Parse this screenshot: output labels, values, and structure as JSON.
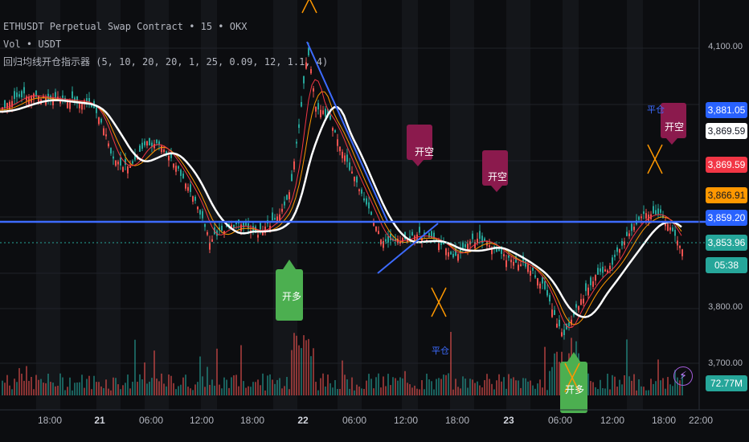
{
  "header": {
    "symbol_line": "ETHUSDT Perpetual Swap Contract • 15 • OKX",
    "volume_line": "Vol • USDT",
    "indicator_line": "回归均线开仓指示器 (5, 10, 20, 20, 1, 25, 0.09, 12, 1.1, 4)"
  },
  "price_axis": {
    "ticks": [
      "4,100.00",
      "3,800.00",
      "3,700.00"
    ],
    "badges": [
      {
        "label": "3,881.05",
        "color": "#2962ff",
        "text_color": "#ffffff"
      },
      {
        "label": "3,869.59",
        "color": "#ffffff",
        "text_color": "#131722"
      },
      {
        "label": "3,869.59",
        "color": "#f23645",
        "text_color": "#ffffff"
      },
      {
        "label": "3,866.91",
        "color": "#ff9800",
        "text_color": "#131722"
      },
      {
        "label": "3,859.20",
        "color": "#2962ff",
        "text_color": "#ffffff"
      },
      {
        "label": "3,853.96",
        "color": "#26a69a",
        "text_color": "#ffffff"
      },
      {
        "label": "05:38",
        "color": "#26a69a",
        "text_color": "#ffffff"
      },
      {
        "label": "72.77M",
        "color": "#26a69a",
        "text_color": "#ffffff"
      }
    ]
  },
  "time_axis": {
    "labels": [
      "18:00",
      "21",
      "06:00",
      "12:00",
      "18:00",
      "22",
      "06:00",
      "12:00",
      "18:00",
      "23",
      "06:00",
      "12:00",
      "18:00",
      "22:00"
    ]
  },
  "signals": {
    "open_short": "开空",
    "open_long": "开多",
    "close": "平仓"
  },
  "colors": {
    "background": "#0c0d10",
    "up": "#26a69a",
    "down": "#ef5350",
    "line_blue": "#3d6bff",
    "short_marker": "#8b1a4d",
    "long_marker": "#4caf50",
    "cross": "#ff9800"
  },
  "icons": {
    "alert": "lightning-icon"
  }
}
